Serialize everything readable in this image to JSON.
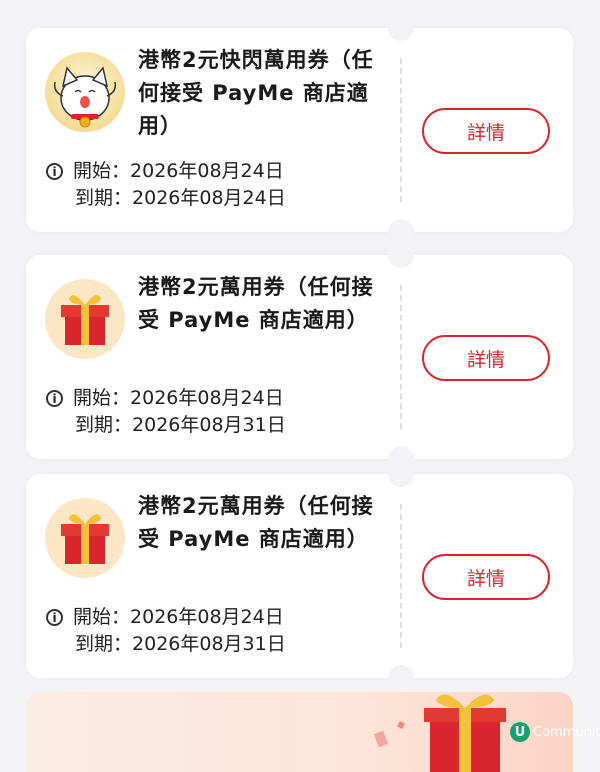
{
  "coupons": [
    {
      "title": "港幣2元快閃萬用券（任何接受 PayMe 商店適用）",
      "start_label": "開始：",
      "start_date": "2026年08月24日",
      "end_label": "到期：",
      "end_date": "2026年08月24日",
      "button": "詳情",
      "icon": "lucky-cat-icon"
    },
    {
      "title": "港幣2元萬用券（任何接受 PayMe 商店適用）",
      "start_label": "開始：",
      "start_date": "2026年08月24日",
      "end_label": "到期：",
      "end_date": "2026年08月31日",
      "button": "詳情",
      "icon": "gift-box-icon"
    },
    {
      "title": "港幣2元萬用券（任何接受 PayMe 商店適用）",
      "start_label": "開始：",
      "start_date": "2026年08月24日",
      "end_label": "到期：",
      "end_date": "2026年08月31日",
      "button": "詳情",
      "icon": "gift-box-icon"
    }
  ],
  "watermark": {
    "logo": "U",
    "text": "Communit"
  },
  "colors": {
    "accent": "#d8262c",
    "background": "#f3f3f5",
    "card": "#ffffff"
  }
}
